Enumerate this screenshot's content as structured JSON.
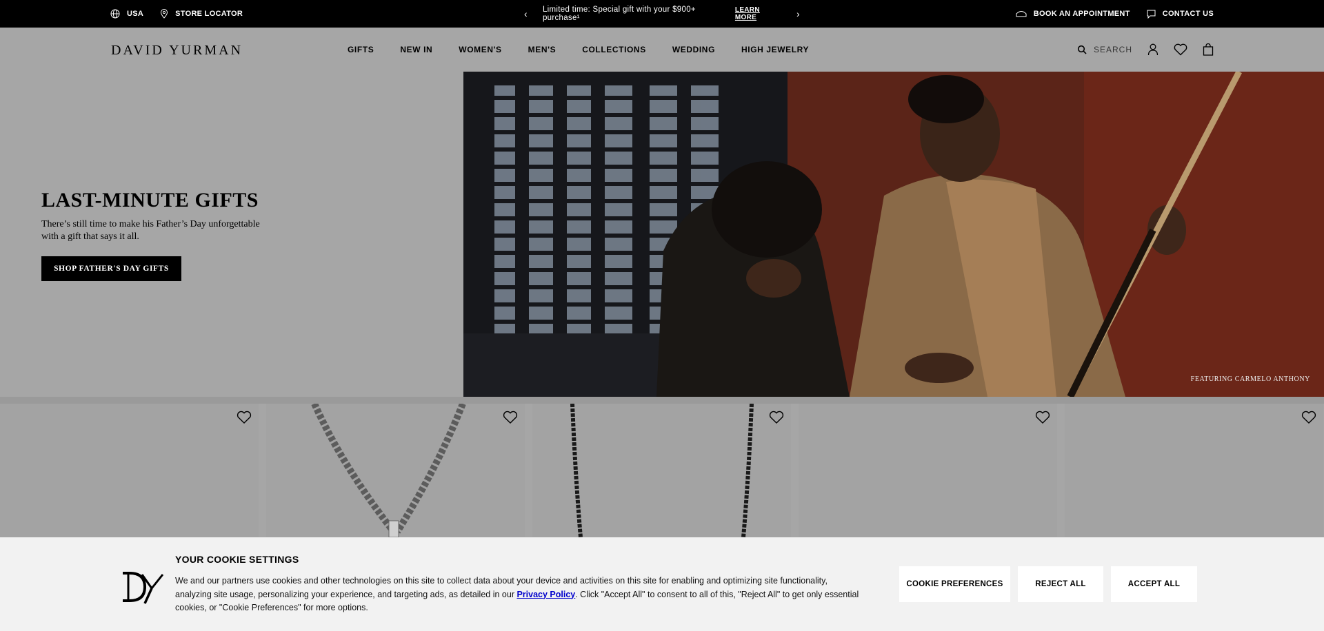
{
  "topbar": {
    "country": "USA",
    "store_locator": "STORE LOCATOR",
    "promo_text": "Limited time: Special gift with your $900+ purchase¹",
    "promo_link": "LEARN MORE",
    "book_appointment": "BOOK AN APPOINTMENT",
    "contact_us": "CONTACT US"
  },
  "header": {
    "logo": "DAVID YURMAN",
    "nav": [
      "GIFTS",
      "NEW IN",
      "WOMEN'S",
      "MEN'S",
      "COLLECTIONS",
      "WEDDING",
      "HIGH JEWELRY"
    ],
    "search_label": "SEARCH"
  },
  "hero": {
    "title": "LAST-MINUTE GIFTS",
    "subtitle": "There’s still time to make his Father’s Day unforgettable with a gift that says it all.",
    "cta": "SHOP FATHER'S DAY GIFTS",
    "caption": "FEATURING CARMELO ANTHONY"
  },
  "cookie": {
    "title": "YOUR COOKIE SETTINGS",
    "text_before": "We and our partners use cookies and other technologies on this site to collect data about your device and activities on this site for enabling and optimizing site functionality, analyzing site usage, personalizing your experience, and targeting ads, as detailed in our ",
    "link": "Privacy Policy",
    "text_after": ". Click \"Accept All\" to consent to all of this, \"Reject All\" to get only essential cookies, or \"Cookie Preferences\" for more options.",
    "preferences": "COOKIE PREFERENCES",
    "reject": "REJECT ALL",
    "accept": "ACCEPT ALL"
  }
}
